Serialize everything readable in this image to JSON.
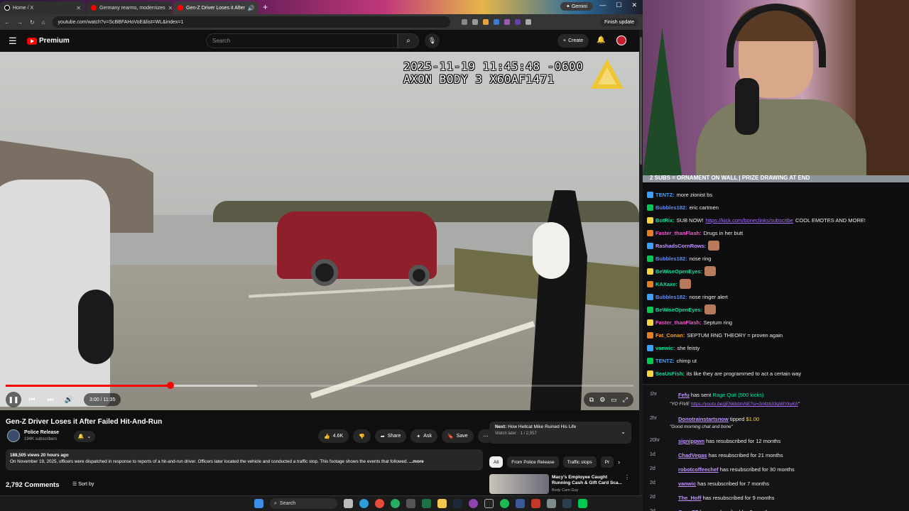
{
  "browser": {
    "tabs": [
      {
        "label": "Home / X",
        "color": "#000000"
      },
      {
        "label": "Germany rearms, modernizes",
        "color": "#ff0000"
      },
      {
        "label": "Gen-Z Driver Loses it After",
        "color": "#ff0000"
      }
    ],
    "gemini_label": "Gemini",
    "url": "youtube.com/watch?v=ScBBFAHoVoE&list=WL&index=1",
    "finish_update": "Finish update"
  },
  "youtube": {
    "logo_text": "Premium",
    "search_placeholder": "Search",
    "create_label": "Create"
  },
  "video": {
    "timestamp_line1": "2025-11-19 11:45:48 -0600",
    "timestamp_line2": "AXON BODY 3 X60AF1471",
    "progress_fraction": 0.262,
    "buffered_fraction": 0.4,
    "time_display": "3:00 / 11:35"
  },
  "details": {
    "title": "Gen-Z Driver Loses it After Failed Hit-And-Run",
    "channel": "Police Release",
    "subscribers": "194K subscribers",
    "likes": "4.6K",
    "share": "Share",
    "ask": "Ask",
    "save": "Save",
    "views_date": "188,505 views  20 hours ago",
    "description": "On November 19, 2025, officers were dispatched in response to reports of a hit-and-run driver. Officers later located the vehicle and conducted a traffic stop. This footage shows the events that followed.",
    "more": "...more",
    "comments_count": "2,792 Comments",
    "sort_by": "Sort by"
  },
  "sidebar": {
    "next_prefix": "Next:",
    "next_title": "How Hellcat Mike Ruined His Life",
    "watch_later": "Watch later · 1 / 2,957",
    "chips": [
      "All",
      "From Police Release",
      "Traffic stops",
      "Pr"
    ],
    "reco_title": "Macy's Employee Caught Running Cash & Gift Card Sca...",
    "reco_channel": "Body Cam Guy"
  },
  "stream": {
    "banner": "2 SUBS = ORNAMENT ON WALL | PRIZE DRAWING AT END",
    "chat": [
      {
        "user": "TENTZ",
        "color": "#3aa0ff",
        "text": "more zionist bs"
      },
      {
        "user": "Bubbles182",
        "color": "#5b8cff",
        "text": "eric cartmen"
      },
      {
        "user": "BotRix",
        "color": "#00e5a0",
        "text": "SUB NOW! ",
        "link": "https://kick.com/boneclinks/subscribe",
        "after": " COOL EMOTES AND MORE!"
      },
      {
        "user": "Faster_thanFlash",
        "color": "#ff4fd8",
        "text": "Drugs in her butt"
      },
      {
        "user": "RashadsCornRows",
        "color": "#bf94ff",
        "text": ""
      },
      {
        "user": "Bubbles182",
        "color": "#5b8cff",
        "text": "nose ring"
      },
      {
        "user": "BeWiseOpenEyes",
        "color": "#00e5a0",
        "text": ""
      },
      {
        "user": "KAXaxe",
        "color": "#00e5a0",
        "text": ""
      },
      {
        "user": "Bubbles182",
        "color": "#5b8cff",
        "text": "nose ringer alert"
      },
      {
        "user": "BeWiseOpenEyes",
        "color": "#00e5a0",
        "text": ""
      },
      {
        "user": "Faster_thanFlash",
        "color": "#ff4fd8",
        "text": "Septum ring"
      },
      {
        "user": "Fat_Conan",
        "color": "#ff9f1a",
        "text": "SEPTUM RNG THEORY = proven again"
      },
      {
        "user": "vanwic",
        "color": "#00e5a0",
        "text": "she feisty"
      },
      {
        "user": "TENTZ",
        "color": "#3aa0ff",
        "text": "chimp ut"
      },
      {
        "user": "SeaUsFish",
        "color": "#00e5a0",
        "text": "its like they are programmed to act a certain way"
      }
    ],
    "events": [
      {
        "time": "1hr",
        "user": "Fefu",
        "text": " has sent ",
        "gift": "Rage Quit (500 kicks)",
        "quote_prefix": "\"YO FIVE ",
        "quote_link": "https://youtu.be/jjEN6bbtnNE?si=0rl4zb33qWtYkyKh",
        "quote_suffix": "\""
      },
      {
        "time": "2hr",
        "user": "Donotrainstartsnow",
        "text": " tipped ",
        "amount": "$1.00",
        "quote": "\"Good morning chat and bone\""
      },
      {
        "time": "20hr",
        "user": "signippwn",
        "text": " has resubscribed for 12 months"
      },
      {
        "time": "1d",
        "user": "ChadVegas",
        "text": " has resubscribed for 21 months"
      },
      {
        "time": "2d",
        "user": "robotcoffeechef",
        "text": " has resubscribed for 30 months"
      },
      {
        "time": "2d",
        "user": "vanwic",
        "text": " has resubscribed for 7 months"
      },
      {
        "time": "2d",
        "user": "The_Hoff",
        "text": " has resubscribed for 9 months"
      },
      {
        "time": "2d",
        "user": "GenoZZ",
        "text": " has resubscribed for 3 months"
      }
    ]
  },
  "taskbar": {
    "search_label": "Search"
  }
}
